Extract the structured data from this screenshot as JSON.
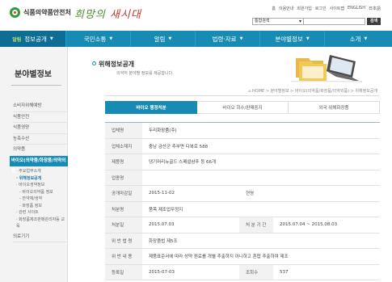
{
  "header": {
    "logo_text": "식품의약품안전처",
    "slogan_part1": "희망의",
    "slogan_part2": "새시대",
    "util_links": [
      "홈",
      "이용안내",
      "회원가입",
      "로그인",
      "사이트맵",
      "ENGLISH",
      "日本語"
    ],
    "search_select": "통합검색",
    "search_button": "검색"
  },
  "nav": {
    "items": [
      {
        "badge": "알림",
        "label": "정보공개"
      },
      {
        "label": "국민소통"
      },
      {
        "label": "알림"
      },
      {
        "label": "법령·자료"
      },
      {
        "label": "분야별정보"
      },
      {
        "label": "소개"
      }
    ]
  },
  "sidebar": {
    "title": "분야별정보",
    "items": [
      "소비자위해예방",
      "식품안전",
      "식품영양",
      "농축수산",
      "의약품"
    ],
    "active": "바이오(의약품/화장품/의약외품)",
    "subs": [
      {
        "label": "· 주요업무소개",
        "level": 1,
        "selected": false
      },
      {
        "label": "· 위해정보공개",
        "level": 1,
        "selected": true
      },
      {
        "label": "· 바이오생약정보",
        "level": 1,
        "selected": false
      },
      {
        "label": "- 바이오의약품 정보",
        "level": 2,
        "selected": false
      },
      {
        "label": "- 한약재/생약",
        "level": 2,
        "selected": false
      },
      {
        "label": "- 화장품 정보",
        "level": 2,
        "selected": false
      },
      {
        "label": "· 관련 사이트",
        "level": 1,
        "selected": false
      },
      {
        "label": "· 화장품제조판매관리자등 교육",
        "level": 1,
        "selected": false
      }
    ],
    "last_item": "의료기기"
  },
  "main": {
    "title": "위해정보공개",
    "desc": "의약처 분야별 정보를 제공합니다.",
    "breadcrumb": "⌂ HOME > 분야별정보 > 바이오(의약품/화장품/의약외품) > 위해정보공개",
    "tabs": [
      "바이오 행정처분",
      "바이오 회수/판매중지",
      "외국 위해화장품"
    ],
    "rows": [
      {
        "label": "업체명",
        "value": "두리화장품(주)"
      },
      {
        "label": "업체소재지",
        "value": "충남 금산군 추부면 다복로 588"
      },
      {
        "label": "제품명",
        "value": "댕기머리뉴골드 스페셜샴푸 등 66개"
      },
      {
        "label": "업종명",
        "value": ""
      },
      {
        "label": "공개마감일",
        "value": "2015-11-02",
        "label2": "현명",
        "value2": ""
      },
      {
        "label": "처분명",
        "value": "품목 제조업무정지"
      },
      {
        "label": "처분일",
        "value": "2015.07.03",
        "label2": "처 분 기 간",
        "value2": "2015.07.04 ~ 2015.08.03"
      },
      {
        "label": "위 반 법 령",
        "value": "화장품법 제5조"
      },
      {
        "label": "위 반 내 용",
        "value": "제품표준서에 따라 성약 원료를 개별 추출하지 아니하고 혼합 추출하여 제조"
      },
      {
        "label": "등록일",
        "value": "2015-07-03",
        "label2": "조회수",
        "value2": "537"
      }
    ]
  },
  "colors": {
    "nav": "#178bb3",
    "nav_active": "#0e6d94",
    "brand_green": "#2f9a3e"
  }
}
